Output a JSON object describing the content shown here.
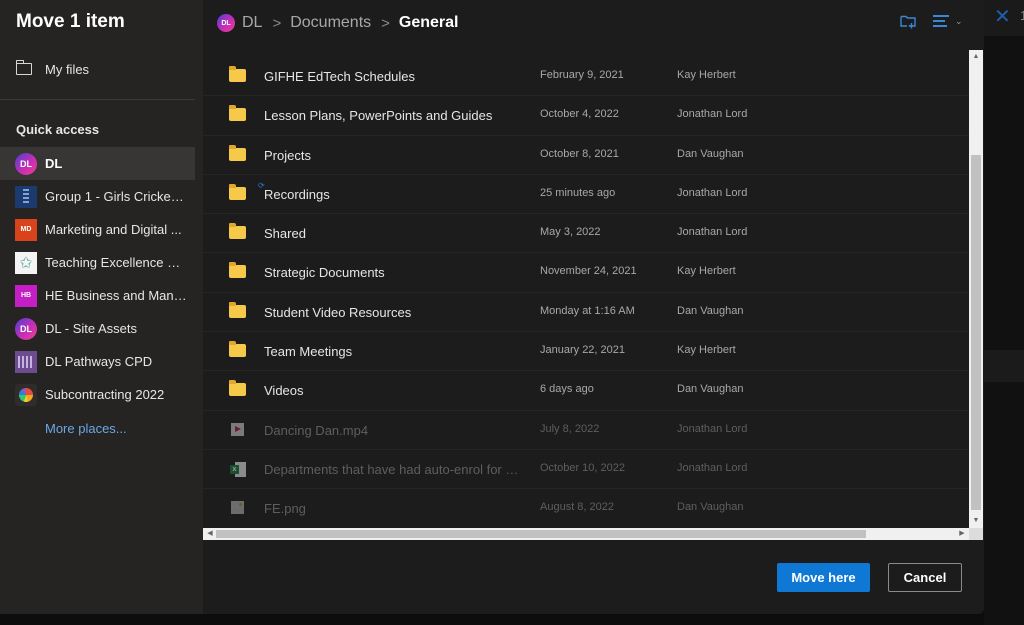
{
  "dialog": {
    "title": "Move 1 item"
  },
  "sidebar": {
    "my_files": "My files",
    "quick_access_title": "Quick access",
    "quick_access": [
      {
        "name": "DL",
        "logo": "DL",
        "icon": "dl-site-logo-icon",
        "active": true
      },
      {
        "name": "Group 1 - Girls Cricket ...",
        "logo": "",
        "icon": "cricket-logo-icon",
        "active": false
      },
      {
        "name": "Marketing and Digital ...",
        "logo": "MD",
        "icon": "md-logo-icon",
        "active": false
      },
      {
        "name": "Teaching Excellence Pr...",
        "logo": "✩",
        "icon": "star-logo-icon",
        "active": false
      },
      {
        "name": "HE Business and Mana...",
        "logo": "HB",
        "icon": "hb-logo-icon",
        "active": false
      },
      {
        "name": "DL - Site Assets",
        "logo": "DL",
        "icon": "dl-site-logo-icon",
        "active": false
      },
      {
        "name": "DL Pathways CPD",
        "logo": "",
        "icon": "pathways-logo-icon",
        "active": false
      },
      {
        "name": "Subcontracting 2022",
        "logo": "",
        "icon": "color-wheel-logo-icon",
        "active": false
      }
    ],
    "more_places": "More places..."
  },
  "breadcrumb": {
    "logo": "DL",
    "items": [
      "DL",
      "Documents"
    ],
    "separator": ">",
    "current": "General"
  },
  "toolbar": {
    "chevron": "⌄"
  },
  "files": [
    {
      "name": "GIFHE EdTech Schedules",
      "modified": "February 9, 2021",
      "modified_by": "Kay Herbert",
      "type": "folder",
      "disabled": false,
      "syncing": false
    },
    {
      "name": "Lesson Plans, PowerPoints and Guides",
      "modified": "October 4, 2022",
      "modified_by": "Jonathan Lord",
      "type": "folder",
      "disabled": false,
      "syncing": false
    },
    {
      "name": "Projects",
      "modified": "October 8, 2021",
      "modified_by": "Dan Vaughan",
      "type": "folder",
      "disabled": false,
      "syncing": false
    },
    {
      "name": "Recordings",
      "modified": "25 minutes ago",
      "modified_by": "Jonathan Lord",
      "type": "folder",
      "disabled": false,
      "syncing": true
    },
    {
      "name": "Shared",
      "modified": "May 3, 2022",
      "modified_by": "Jonathan Lord",
      "type": "folder",
      "disabled": false,
      "syncing": false
    },
    {
      "name": "Strategic Documents",
      "modified": "November 24, 2021",
      "modified_by": "Kay Herbert",
      "type": "folder",
      "disabled": false,
      "syncing": false
    },
    {
      "name": "Student Video Resources",
      "modified": "Monday at 1:16 AM",
      "modified_by": "Dan Vaughan",
      "type": "folder",
      "disabled": false,
      "syncing": false
    },
    {
      "name": "Team Meetings",
      "modified": "January 22, 2021",
      "modified_by": "Kay Herbert",
      "type": "folder",
      "disabled": false,
      "syncing": false
    },
    {
      "name": "Videos",
      "modified": "6 days ago",
      "modified_by": "Dan Vaughan",
      "type": "folder",
      "disabled": false,
      "syncing": false
    },
    {
      "name": "Dancing Dan.mp4",
      "modified": "July 8, 2022",
      "modified_by": "Jonathan Lord",
      "type": "video",
      "disabled": true,
      "syncing": false
    },
    {
      "name": "Departments that have had auto-enrol for n...",
      "modified": "October 10, 2022",
      "modified_by": "Jonathan Lord",
      "type": "excel",
      "disabled": true,
      "syncing": false
    },
    {
      "name": "FE.png",
      "modified": "August 8, 2022",
      "modified_by": "Dan Vaughan",
      "type": "image",
      "disabled": true,
      "syncing": false
    }
  ],
  "scrollbars": {
    "vertical_position_fraction": 0.25,
    "horizontal_position_fraction": 0.0
  },
  "footer": {
    "primary_label": "Move here",
    "cancel_label": "Cancel"
  },
  "background": {
    "partial_count": "1"
  },
  "colors": {
    "accent": "#0f78d4",
    "link": "#6aa8e6",
    "folder": "#f6c94a"
  }
}
